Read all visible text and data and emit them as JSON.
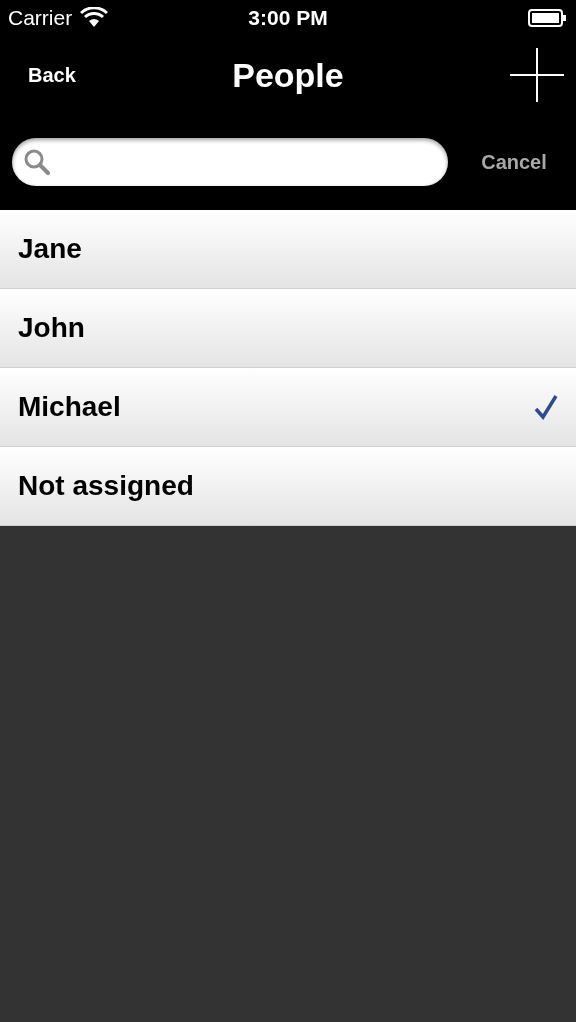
{
  "status_bar": {
    "carrier": "Carrier",
    "time": "3:00 PM"
  },
  "nav_bar": {
    "back": "Back",
    "title": "People"
  },
  "search": {
    "cancel": "Cancel"
  },
  "rows": [
    {
      "label": "Jane",
      "selected": false
    },
    {
      "label": "John",
      "selected": false
    },
    {
      "label": "Michael",
      "selected": true
    },
    {
      "label": "Not assigned",
      "selected": false
    }
  ]
}
